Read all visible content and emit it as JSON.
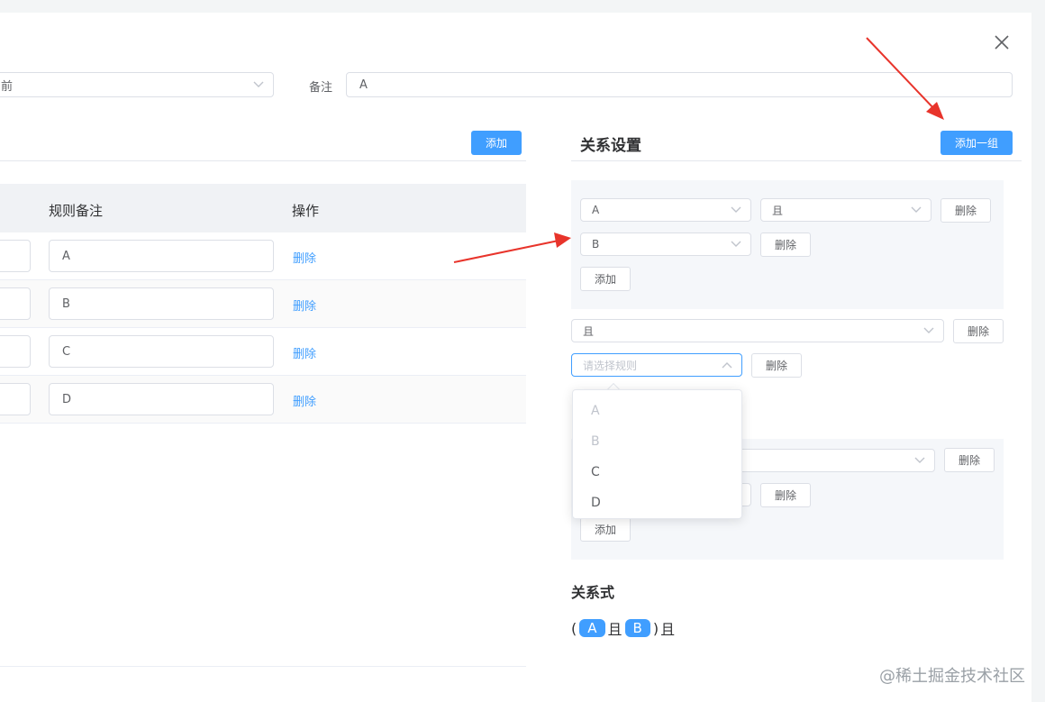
{
  "form": {
    "select_value_partial": "前",
    "remark_label": "备注",
    "remark_value": "A"
  },
  "rules": {
    "add_button": "添加",
    "columns": [
      "规则备注",
      "操作"
    ],
    "rows": [
      {
        "remark": "A",
        "action": "删除"
      },
      {
        "remark": "B",
        "action": "删除"
      },
      {
        "remark": "C",
        "action": "删除"
      },
      {
        "remark": "D",
        "action": "删除"
      }
    ]
  },
  "relation": {
    "title": "关系设置",
    "add_group_button": "添加一组",
    "group1": {
      "rule1": "A",
      "operator": "且",
      "delete_label": "删除",
      "rule2": "B",
      "rule2_delete_label": "删除",
      "add_label": "添加"
    },
    "group2": {
      "operator": "且",
      "delete_label": "删除",
      "rule_placeholder": "请选择规则",
      "rule_delete_label": "删除"
    },
    "group3": {
      "delete_label": "删除",
      "rule_delete_label": "删除",
      "add_label": "添加"
    },
    "dropdown_options": [
      {
        "label": "A",
        "disabled": true
      },
      {
        "label": "B",
        "disabled": true
      },
      {
        "label": "C",
        "disabled": false
      },
      {
        "label": "D",
        "disabled": false
      }
    ],
    "formula_title": "关系式",
    "formula": {
      "open": "(",
      "tag1": "A",
      "op1": "且",
      "tag2": "B",
      "close": ")",
      "op2": "且"
    }
  },
  "watermark": "@稀土掘金技术社区",
  "colors": {
    "primary": "#409eff",
    "arrow": "#e8342b"
  }
}
